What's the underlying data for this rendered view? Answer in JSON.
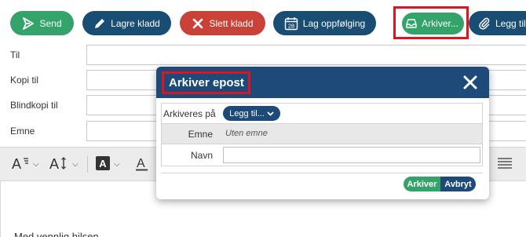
{
  "toolbar": {
    "send_label": "Send",
    "lagre_label": "Lagre kladd",
    "slett_label": "Slett kladd",
    "lagopp_label": "Lag oppfølging",
    "lagopp_icon_day": "28",
    "arkiver_label": "Arkiver...",
    "leggtil_label": "Legg til"
  },
  "fields": {
    "til_label": "Til",
    "kopi_label": "Kopi til",
    "blindkopi_label": "Blindkopi til",
    "emne_label": "Emne"
  },
  "editor": {
    "signature": "Med vennlig hilsen"
  },
  "dialog": {
    "title": "Arkiver epost",
    "rows": {
      "arkiveres_label": "Arkiveres på",
      "legg_til_label": "Legg til...",
      "emne_label": "Emne",
      "emne_value": "Uten emne",
      "navn_label": "Navn",
      "navn_value": ""
    },
    "arkiver_button": "Arkiver",
    "avbryt_button": "Avbryt"
  },
  "colors": {
    "green": "#34a36a",
    "navy": "#1a4d73",
    "red": "#c94137",
    "dialog_header": "#1d4a78",
    "highlight": "#e0141e"
  },
  "icons": {
    "send": "send-arrow-icon",
    "lagre": "pencil-icon",
    "slett": "x-icon",
    "lagopp": "calendar-icon",
    "arkiver": "inbox-archive-icon",
    "leggtil": "paperclip-icon",
    "close": "close-icon"
  }
}
